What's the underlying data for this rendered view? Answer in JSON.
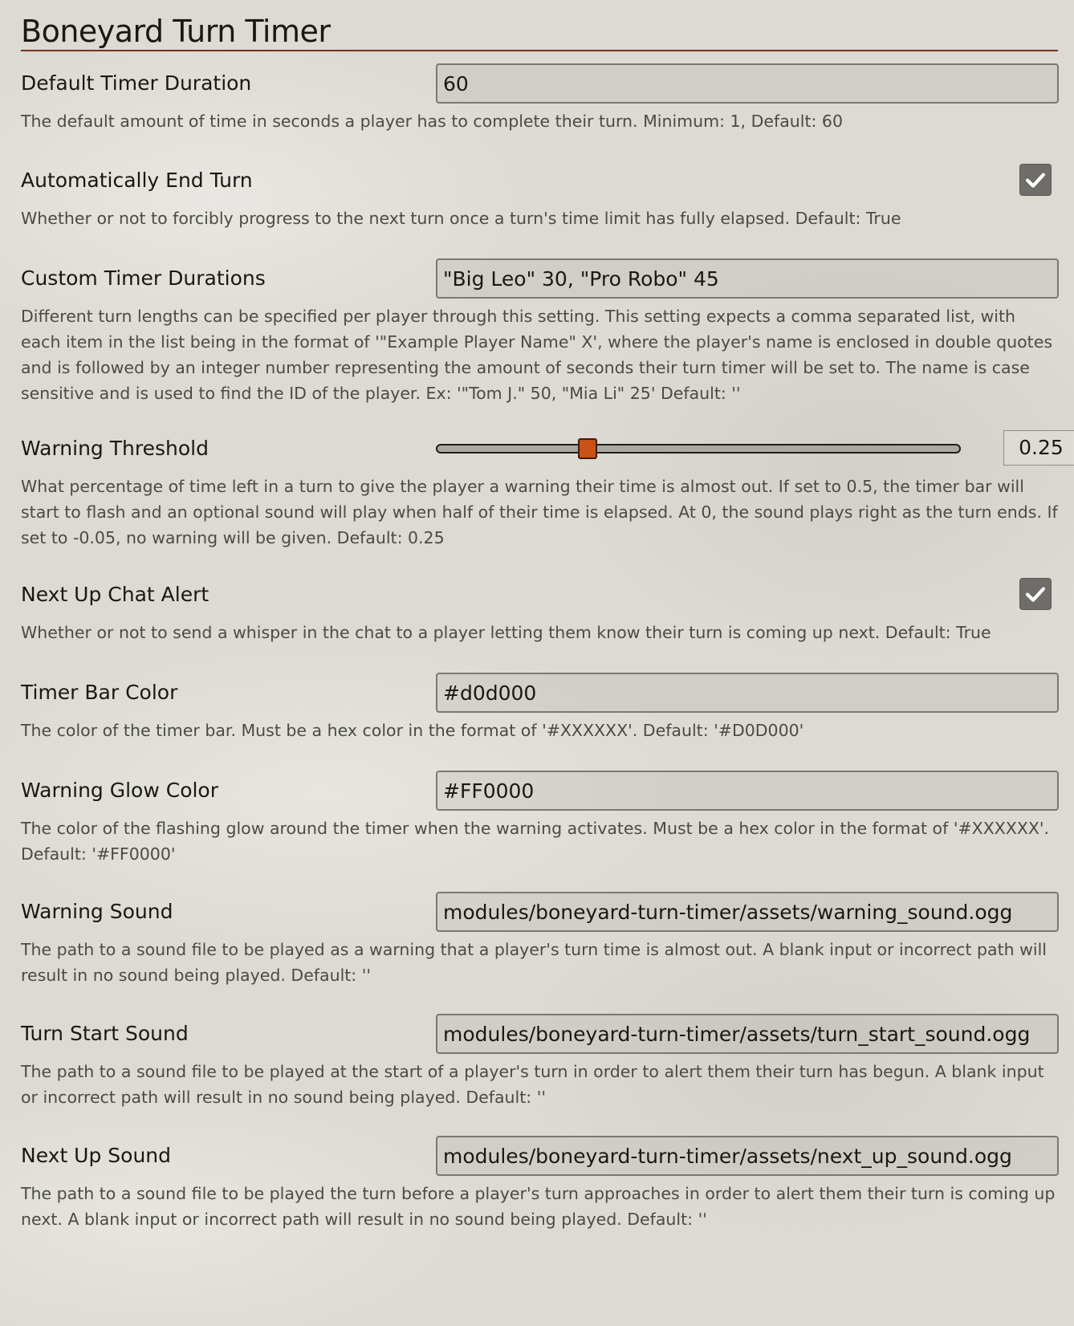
{
  "module_title": "Boneyard Turn Timer",
  "settings": {
    "default_duration": {
      "label": "Default Timer Duration",
      "value": "60",
      "notes": "The default amount of time in seconds a player has to complete their turn. Minimum: 1, Default: 60"
    },
    "auto_end_turn": {
      "label": "Automatically End Turn",
      "checked": true,
      "notes": "Whether or not to forcibly progress to the next turn once a turn's time limit has fully elapsed. Default: True"
    },
    "custom_durations": {
      "label": "Custom Timer Durations",
      "value": "\"Big Leo\" 30, \"Pro Robo\" 45",
      "notes": "Different turn lengths can be specified per player through this setting. This setting expects a comma separated list, with each item in the list being in the format of '\"Example Player Name\" X', where the player's name is enclosed in double quotes and is followed by an integer number representing the amount of seconds their turn timer will be set to. The name is case sensitive and is used to find the ID of the player. Ex: '\"Tom J.\" 50, \"Mia Li\" 25' Default: ''"
    },
    "warning_threshold": {
      "label": "Warning Threshold",
      "value": 0.25,
      "display": "0.25",
      "min": -0.05,
      "max": 1,
      "notes": "What percentage of time left in a turn to give the player a warning their time is almost out. If set to 0.5, the timer bar will start to flash and an optional sound will play when half of their time is elapsed. At 0, the sound plays right as the turn ends. If set to -0.05, no warning will be given. Default: 0.25"
    },
    "next_up_chat": {
      "label": "Next Up Chat Alert",
      "checked": true,
      "notes": "Whether or not to send a whisper in the chat to a player letting them know their turn is coming up next. Default: True"
    },
    "timer_bar_color": {
      "label": "Timer Bar Color",
      "value": "#d0d000",
      "notes": "The color of the timer bar. Must be a hex color in the format of '#XXXXXX'. Default: '#D0D000'"
    },
    "warning_glow_color": {
      "label": "Warning Glow Color",
      "value": "#FF0000",
      "notes": "The color of the flashing glow around the timer when the warning activates. Must be a hex color in the format of '#XXXXXX'. Default: '#FF0000'"
    },
    "warning_sound": {
      "label": "Warning Sound",
      "value": "modules/boneyard-turn-timer/assets/warning_sound.ogg",
      "notes": "The path to a sound file to be played as a warning that a player's turn time is almost out. A blank input or incorrect path will result in no sound being played. Default: ''"
    },
    "turn_start_sound": {
      "label": "Turn Start Sound",
      "value": "modules/boneyard-turn-timer/assets/turn_start_sound.ogg",
      "notes": "The path to a sound file to be played at the start of a player's turn in order to alert them their turn has begun. A blank input or incorrect path will result in no sound being played. Default: ''"
    },
    "next_up_sound": {
      "label": "Next Up Sound",
      "value": "modules/boneyard-turn-timer/assets/next_up_sound.ogg",
      "notes": "The path to a sound file to be played the turn before a player's turn approaches in order to alert them their turn is coming up next. A blank input or incorrect path will result in no sound being played. Default: ''"
    }
  },
  "icons": {
    "checkbox": "check-icon"
  },
  "colors": {
    "title_rule": "#782e22",
    "slider_thumb": "#c85116",
    "checkbox_bg": "#6e6d6a"
  }
}
